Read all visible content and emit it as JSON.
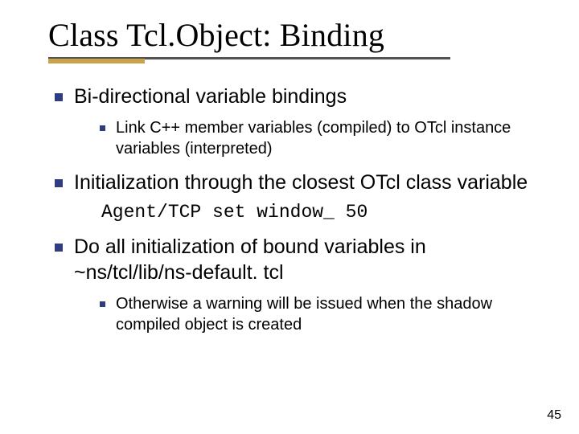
{
  "title": "Class Tcl.Object: Binding",
  "bullets": {
    "b1": "Bi-directional variable bindings",
    "b1_sub1": "Link C++ member variables (compiled) to OTcl instance variables (interpreted)",
    "b2": "Initialization through the closest OTcl class variable",
    "code": "Agent/TCP set window_ 50",
    "b3": "Do all initialization of bound variables in ~ns/tcl/lib/ns-default. tcl",
    "b3_sub1": "Otherwise a warning will be issued when the shadow compiled object is created"
  },
  "page_number": "45"
}
